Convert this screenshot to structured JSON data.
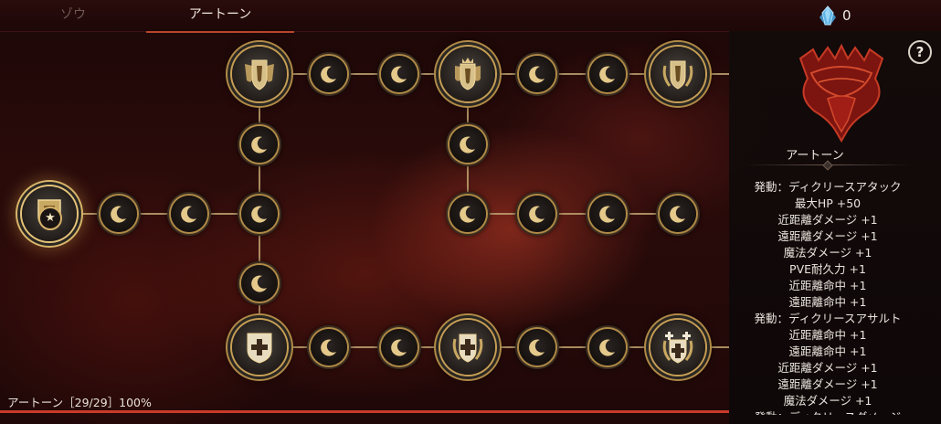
{
  "tabs": [
    {
      "label": "ゾウ",
      "active": false
    },
    {
      "label": "アートーン",
      "active": true
    }
  ],
  "currency": {
    "icon": "crystal-icon",
    "value": "0"
  },
  "panel": {
    "title": "アートーン",
    "help_label": "?",
    "stats": [
      "発動：ディクリースアタック",
      "最大HP  +50",
      "近距離ダメージ  +1",
      "遠距離ダメージ  +1",
      "魔法ダメージ  +1",
      "PVE耐久力  +1",
      "近距離命中  +1",
      "遠距離命中  +1",
      "発動：ディクリースアサルト",
      "近距離命中  +1",
      "遠距離命中  +1",
      "近距離ダメージ  +1",
      "遠距離ダメージ  +1",
      "魔法ダメージ  +1",
      "発動：ディクリースダメージ"
    ]
  },
  "footer": {
    "text": "アートーン［29/29］100%",
    "progress": 1.0
  },
  "tree": {
    "nodes": [
      {
        "id": "start",
        "kind": "start",
        "icon": "shield-emblem-icon"
      },
      {
        "id": "a1",
        "kind": "small",
        "icon": "crescent-moon-icon"
      },
      {
        "id": "a2",
        "kind": "small",
        "icon": "crescent-moon-icon"
      },
      {
        "id": "j1",
        "kind": "small",
        "icon": "crescent-moon-icon"
      },
      {
        "id": "u1",
        "kind": "small",
        "icon": "crescent-moon-icon"
      },
      {
        "id": "d1",
        "kind": "small",
        "icon": "crescent-moon-icon"
      },
      {
        "id": "top1",
        "kind": "big",
        "icon": "winged-shield-icon"
      },
      {
        "id": "t1",
        "kind": "small",
        "icon": "crescent-moon-icon"
      },
      {
        "id": "t2",
        "kind": "small",
        "icon": "crescent-moon-icon"
      },
      {
        "id": "top2",
        "kind": "big",
        "icon": "crowned-shield-icon"
      },
      {
        "id": "t3",
        "kind": "small",
        "icon": "crescent-moon-icon"
      },
      {
        "id": "t4",
        "kind": "small",
        "icon": "crescent-moon-icon"
      },
      {
        "id": "top3",
        "kind": "big",
        "icon": "laurel-shield-icon"
      },
      {
        "id": "u2",
        "kind": "small",
        "icon": "crescent-moon-icon"
      },
      {
        "id": "m1",
        "kind": "small",
        "icon": "crescent-moon-icon"
      },
      {
        "id": "m2",
        "kind": "small",
        "icon": "crescent-moon-icon"
      },
      {
        "id": "m3",
        "kind": "small",
        "icon": "crescent-moon-icon"
      },
      {
        "id": "m4",
        "kind": "small",
        "icon": "crescent-moon-icon"
      },
      {
        "id": "bot1",
        "kind": "big",
        "icon": "cross-shield-icon"
      },
      {
        "id": "b1",
        "kind": "small",
        "icon": "crescent-moon-icon"
      },
      {
        "id": "b2",
        "kind": "small",
        "icon": "crescent-moon-icon"
      },
      {
        "id": "bot2",
        "kind": "big",
        "icon": "cross-laurel-shield-icon"
      },
      {
        "id": "b3",
        "kind": "small",
        "icon": "crescent-moon-icon"
      },
      {
        "id": "b4",
        "kind": "small",
        "icon": "crescent-moon-icon"
      },
      {
        "id": "bot3",
        "kind": "big",
        "icon": "triple-cross-shield-icon"
      }
    ]
  }
}
